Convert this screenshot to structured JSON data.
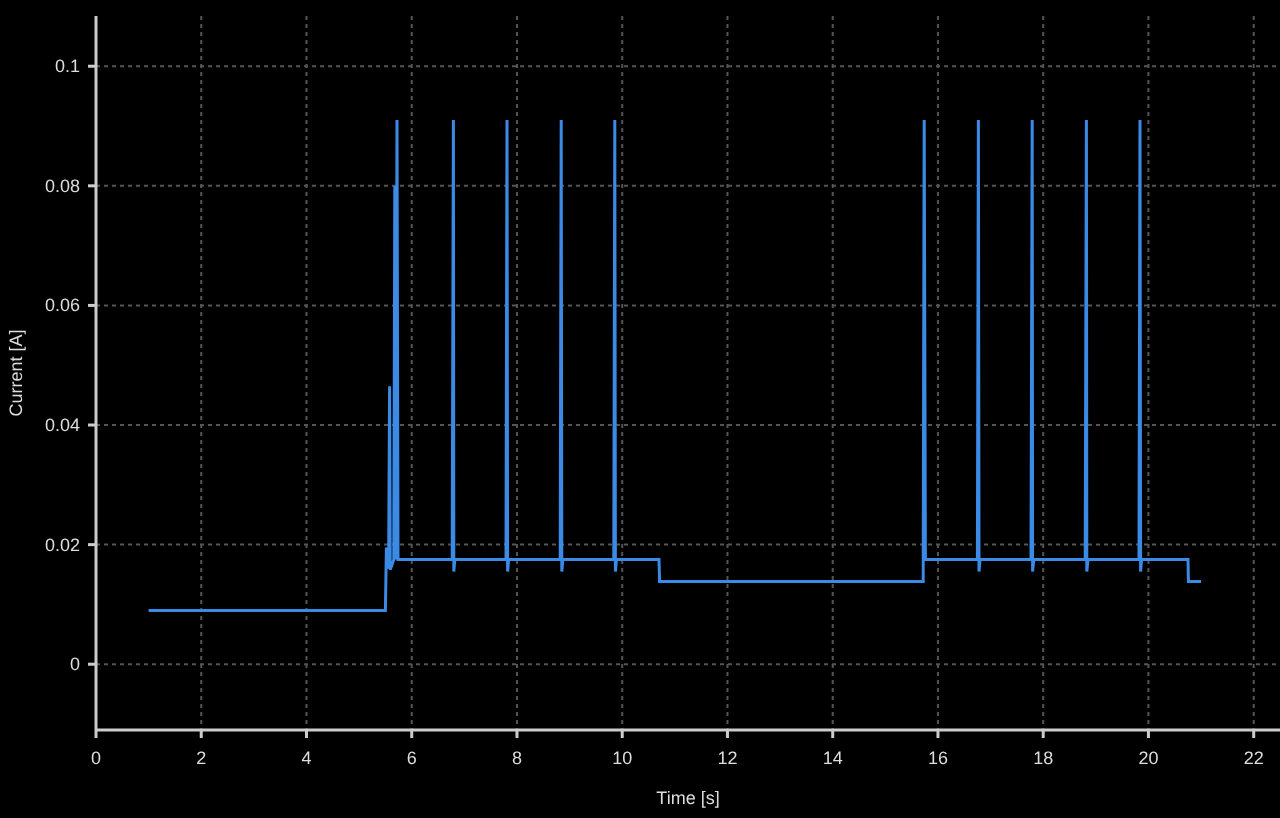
{
  "chart_data": {
    "type": "line",
    "grid": true,
    "xlabel": "Time [s]",
    "ylabel": "Current [A]",
    "xlim": [
      0,
      22.5
    ],
    "ylim": [
      -0.011,
      0.1084
    ],
    "xticks": [
      0,
      2,
      4,
      6,
      8,
      10,
      12,
      14,
      16,
      18,
      20,
      22
    ],
    "yticks": [
      0,
      0.02,
      0.04,
      0.06,
      0.08,
      0.1
    ],
    "x": [
      1,
      5.5,
      5.52,
      5.56,
      5.58,
      5.59,
      5.6,
      5.62,
      5.66,
      5.68,
      5.7,
      5.72,
      5.74,
      5.76,
      6.77,
      6.79,
      6.8,
      6.82,
      7.79,
      7.81,
      7.82,
      7.84,
      8.82,
      8.84,
      8.85,
      8.87,
      9.84,
      9.86,
      9.87,
      9.89,
      10.7,
      10.71,
      15.72,
      15.74,
      15.76,
      16.75,
      16.77,
      16.78,
      16.8,
      17.77,
      17.79,
      17.8,
      17.82,
      18.8,
      18.82,
      18.83,
      18.85,
      19.82,
      19.84,
      19.85,
      19.87,
      20.75,
      20.76,
      21
    ],
    "series": [
      {
        "color": "#3b8ae6",
        "values": [
          0.009,
          0.009,
          0.0195,
          0.016,
          0.0465,
          0.016,
          0.016,
          0.0165,
          0.0175,
          0.08,
          0.0175,
          0.091,
          0.0175,
          0.0175,
          0.0175,
          0.091,
          0.0155,
          0.0175,
          0.0175,
          0.091,
          0.0155,
          0.0175,
          0.0175,
          0.091,
          0.0155,
          0.0175,
          0.0175,
          0.091,
          0.0155,
          0.0175,
          0.0175,
          0.0138,
          0.0138,
          0.091,
          0.0175,
          0.0175,
          0.091,
          0.0155,
          0.0175,
          0.0175,
          0.091,
          0.0155,
          0.0175,
          0.0175,
          0.091,
          0.0155,
          0.0175,
          0.0175,
          0.091,
          0.0155,
          0.0175,
          0.0175,
          0.0138,
          0.0138
        ]
      }
    ]
  }
}
